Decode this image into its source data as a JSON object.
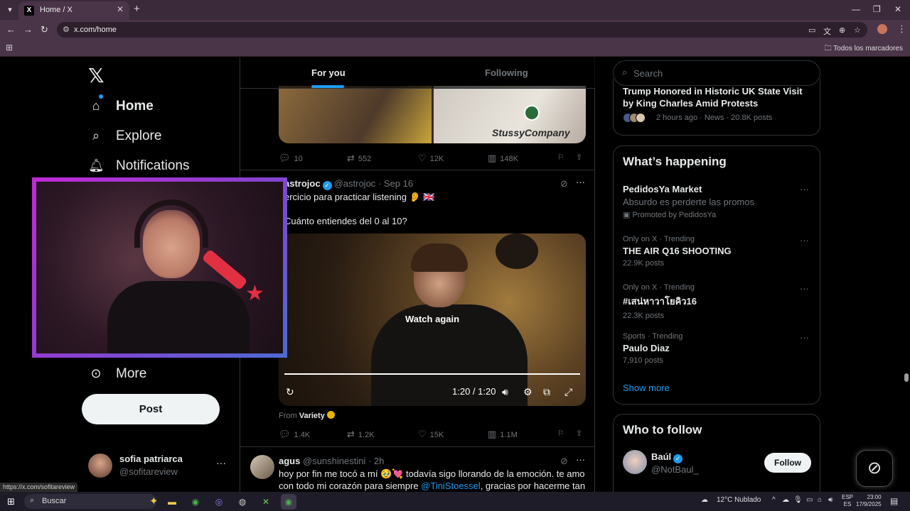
{
  "browser": {
    "tab_title": "Home / X",
    "url": "x.com/home",
    "bookmarks_all": "Todos los marcadores"
  },
  "left_nav": {
    "items": [
      {
        "label": "Home",
        "icon": "home-icon"
      },
      {
        "label": "Explore",
        "icon": "search-icon"
      },
      {
        "label": "Notifications",
        "icon": "bell-icon"
      },
      {
        "label": "More",
        "icon": "more-circle-icon"
      }
    ],
    "post_label": "Post",
    "account": {
      "name": "sofia patriarca",
      "handle": "@sofitareview"
    }
  },
  "feed": {
    "tabs": [
      "For you",
      "Following"
    ],
    "active_tab": "For you",
    "tweet1": {
      "replies": "10",
      "reposts": "552",
      "likes": "12K",
      "views": "148K",
      "image_text": "StussyCompany"
    },
    "tweet2": {
      "name": "astrojoc",
      "handle": "@astrojoc",
      "date": "· Sep 16",
      "line1": "ercicio para practicar listening 👂 🇬🇧",
      "line2": "Cuánto entiendes del 0 al 10?",
      "video": {
        "overlay": "Watch again",
        "time": "1:20 / 1:20",
        "progress": 1.0
      },
      "from_label": "From",
      "from_source": "Variety",
      "replies": "1.4K",
      "reposts": "1.2K",
      "likes": "15K",
      "views": "1.1M"
    },
    "tweet3": {
      "name": "agus",
      "handle": "@sunshinestini",
      "date": "· 2h",
      "line1": "hoy por fin me tocó a mí 🥹💘 todavía sigo llorando de la emoción. te amo",
      "line2_pre": "con todo mi corazón para siempre ",
      "line2_link": "@TiniStoessel",
      "line2_post": ", gracias por hacerme tan"
    }
  },
  "right": {
    "search_placeholder": "Search",
    "news": {
      "title": "Trump Honored in Historic UK State Visit by King Charles Amid Protests",
      "meta": "2 hours ago · News · 20.8K posts"
    },
    "whats_happening_title": "What’s happening",
    "trends": [
      {
        "meta": "",
        "name": "PedidosYa Market",
        "sub": "Absurdo es perderte las promos",
        "posts": "Promoted by PedidosYa"
      },
      {
        "meta": "Only on X · Trending",
        "name": "THE AIR Q16 SHOOTING",
        "sub": "",
        "posts": "22.9K posts"
      },
      {
        "meta": "Only on X · Trending",
        "name": "#เสน่หาวาโยคิว16",
        "sub": "",
        "posts": "22.3K posts"
      },
      {
        "meta": "Sports · Trending",
        "name": "Paulo Diaz",
        "sub": "",
        "posts": "7,910 posts"
      }
    ],
    "show_more": "Show more",
    "who_to_follow_title": "Who to follow",
    "follow_suggestion": {
      "name": "Baúl",
      "handle": "@NotBaul_",
      "button": "Follow"
    }
  },
  "status_bar_url": "https://x.com/sofitareview",
  "taskbar": {
    "search_label": "Buscar",
    "weather": "12°C  Nublado",
    "lang_top": "ESP",
    "lang_bottom": "ES",
    "time": "23:00",
    "date": "17/9/2025"
  },
  "colors": {
    "accent": "#1d9bf0",
    "background": "#000000",
    "webcam_frame": "#c02ad6"
  }
}
